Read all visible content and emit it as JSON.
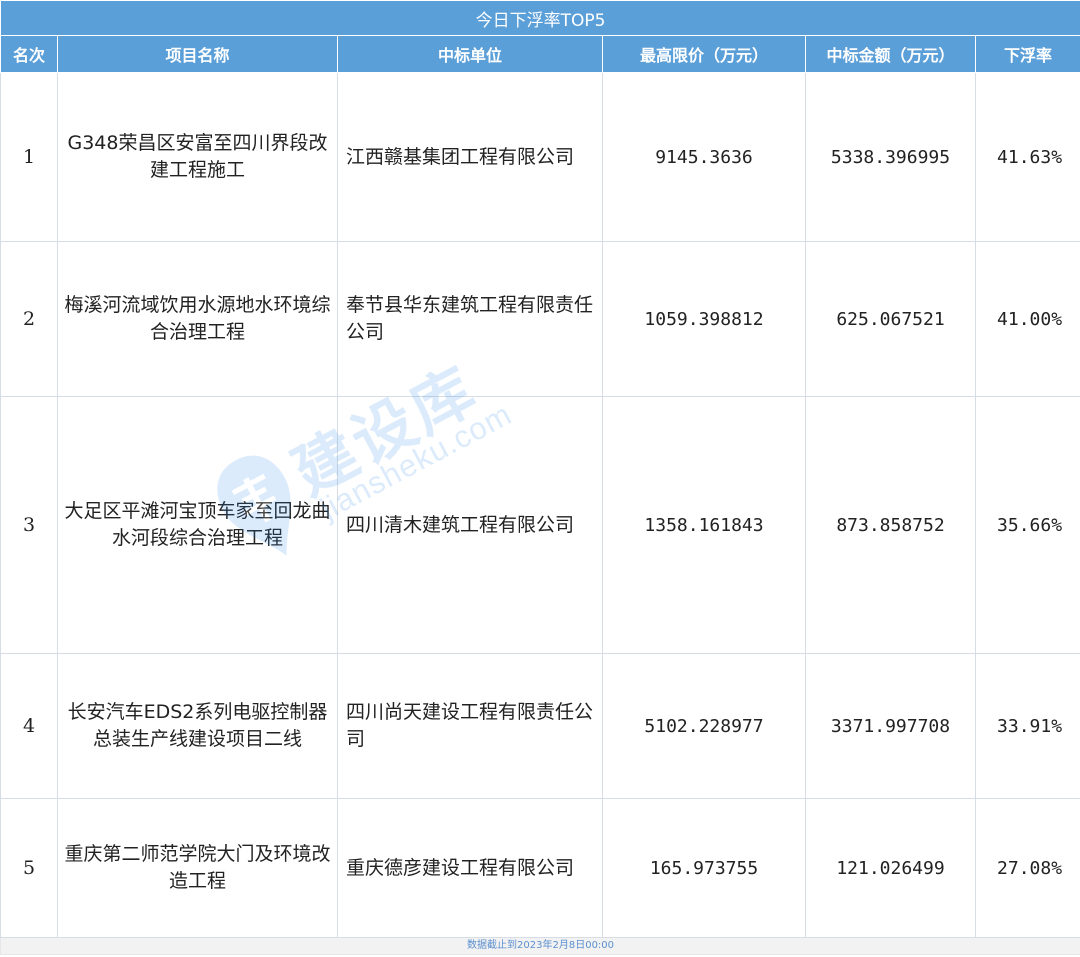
{
  "table": {
    "title": "今日下浮率TOP5",
    "headers": {
      "rank": "名次",
      "project": "项目名称",
      "bidder": "中标单位",
      "max_price": "最高限价（万元）",
      "bid_amount": "中标金额（万元）",
      "rate": "下浮率"
    },
    "rows": [
      {
        "rank": "1",
        "project": "G348荣昌区安富至四川界段改建工程施工",
        "bidder": "江西赣基集团工程有限公司",
        "max_price": "9145.3636",
        "bid_amount": "5338.396995",
        "rate": "41.63%"
      },
      {
        "rank": "2",
        "project": "梅溪河流域饮用水源地水环境综合治理工程",
        "bidder": "奉节县华东建筑工程有限责任公司",
        "max_price": "1059.398812",
        "bid_amount": "625.067521",
        "rate": "41.00%"
      },
      {
        "rank": "3",
        "project": "大足区平滩河宝顶车家至回龙曲水河段综合治理工程",
        "bidder": "四川清木建筑工程有限公司",
        "max_price": "1358.161843",
        "bid_amount": "873.858752",
        "rate": "35.66%"
      },
      {
        "rank": "4",
        "project": "长安汽车EDS2系列电驱控制器总装生产线建设项目二线",
        "bidder": "四川尚天建设工程有限责任公司",
        "max_price": "5102.228977",
        "bid_amount": "3371.997708",
        "rate": "33.91%"
      },
      {
        "rank": "5",
        "project": "重庆第二师范学院大门及环境改造工程",
        "bidder": "重庆德彦建设工程有限公司",
        "max_price": "165.973755",
        "bid_amount": "121.026499",
        "rate": "27.08%"
      }
    ],
    "footer": "数据截止到2023年2月8日00:00"
  },
  "watermark": {
    "brand": "建设库",
    "domain": "jianshеku.com",
    "icon": "jianshe-logo-icon"
  },
  "colors": {
    "header_bg": "#5b9fd9",
    "header_text": "#ffffff",
    "watermark": "#2a8be8",
    "footer_text": "#5b8fcf"
  }
}
